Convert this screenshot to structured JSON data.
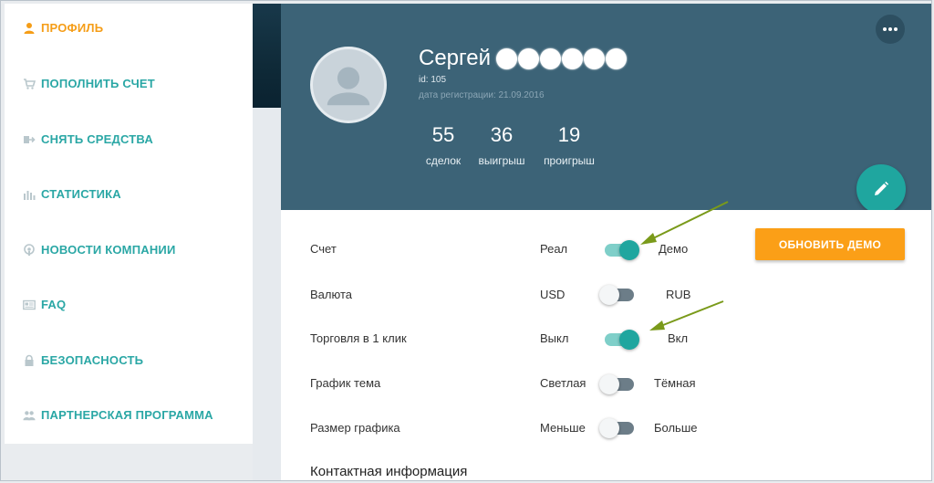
{
  "sidebar": {
    "items": [
      {
        "label": "ПРОФИЛЬ",
        "icon": "user-icon",
        "active": true
      },
      {
        "label": "ПОПОЛНИТЬ СЧЕТ",
        "icon": "cart-icon"
      },
      {
        "label": "СНЯТЬ СРЕДСТВА",
        "icon": "withdraw-icon"
      },
      {
        "label": "СТАТИСТИКА",
        "icon": "bar-chart-icon"
      },
      {
        "label": "НОВОСТИ КОМПАНИИ",
        "icon": "podcast-icon"
      },
      {
        "label": "FAQ",
        "icon": "card-icon"
      },
      {
        "label": "БЕЗОПАСНОСТЬ",
        "icon": "lock-icon"
      },
      {
        "label": "ПАРТНЕРСКАЯ ПРОГРАММА",
        "icon": "users-icon"
      }
    ]
  },
  "profile": {
    "name": "Сергей",
    "id_text": "id: 105",
    "reg_text": "дата регистрации: 21.09.2016",
    "stats": [
      {
        "value": "55",
        "label": "сделок"
      },
      {
        "value": "36",
        "label": "выигрыш"
      },
      {
        "value": "19",
        "label": "проигрыш"
      }
    ],
    "more_icon": "more-horizontal-icon",
    "edit_icon": "pencil-icon"
  },
  "settings": {
    "update_button": "ОБНОВИТЬ ДЕМО",
    "rows": [
      {
        "label": "Счет",
        "left": "Реал",
        "right": "Демо",
        "on": true
      },
      {
        "label": "Валюта",
        "left": "USD",
        "right": "RUB",
        "on": false
      },
      {
        "label": "Торговля в 1 клик",
        "left": "Выкл",
        "right": "Вкл",
        "on": true
      },
      {
        "label": "График тема",
        "left": "Светлая",
        "right": "Тёмная",
        "on": false
      },
      {
        "label": "Размер графика",
        "left": "Меньше",
        "right": "Больше",
        "on": false
      }
    ],
    "contact_title": "Контактная информация"
  },
  "colors": {
    "accent_teal": "#1fa69f",
    "header_bg": "#3c6377",
    "nav_text": "#2aa7a5",
    "nav_active": "#f59d17",
    "update_button_bg": "#fb9f17",
    "arrow": "#7a9a1a"
  }
}
